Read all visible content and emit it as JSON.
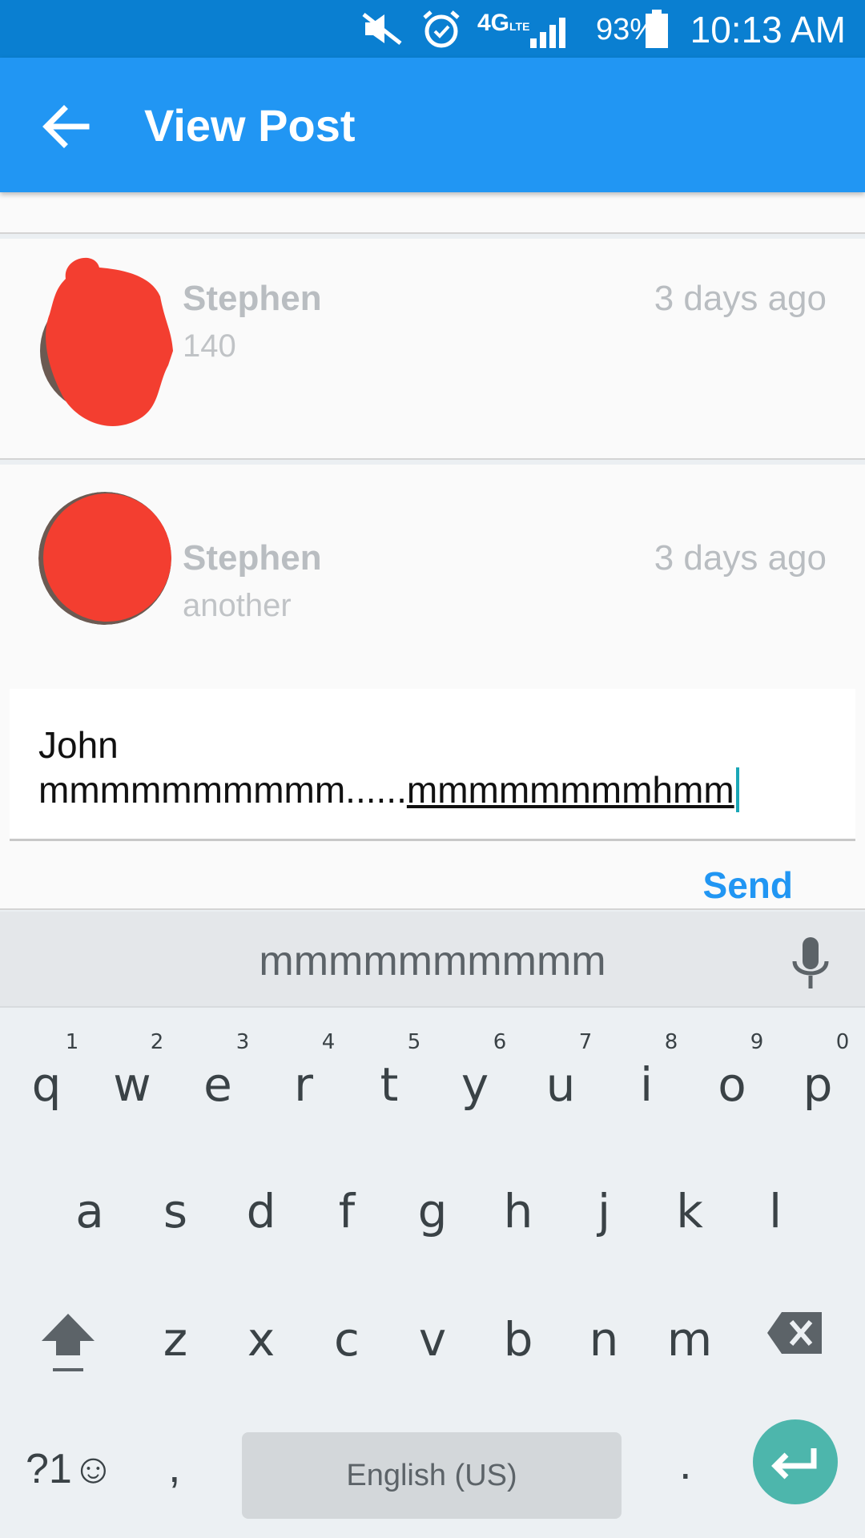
{
  "status_bar": {
    "battery": "93%",
    "time": "10:13 AM",
    "network": "4G LTE",
    "icons": [
      "mute-icon",
      "alarm-icon",
      "network-4g-icon",
      "signal-icon",
      "battery-icon"
    ]
  },
  "app_bar": {
    "title": "View Post",
    "back_icon": "arrow-left-icon"
  },
  "comments": [
    {
      "author": "Stephen",
      "time": "3 days ago",
      "text": "140"
    },
    {
      "author": "Stephen",
      "time": "3 days ago",
      "text": "another"
    }
  ],
  "comment_input": {
    "prefix": "John",
    "line2_plain": "mmmmmmmmmm......",
    "line2_composing": "mmmmmmmmhmm"
  },
  "send_label": "Send",
  "keyboard": {
    "suggestion": "mmmmmmmmmm",
    "row1": [
      "q",
      "w",
      "e",
      "r",
      "t",
      "y",
      "u",
      "i",
      "o",
      "p"
    ],
    "row1_hints": [
      "1",
      "2",
      "3",
      "4",
      "5",
      "6",
      "7",
      "8",
      "9",
      "0"
    ],
    "row2": [
      "a",
      "s",
      "d",
      "f",
      "g",
      "h",
      "j",
      "k",
      "l"
    ],
    "row3": [
      "z",
      "x",
      "c",
      "v",
      "b",
      "n",
      "m"
    ],
    "symbols_label": "?1☺",
    "comma": ",",
    "period": ".",
    "space_label": "English (US)"
  },
  "colors": {
    "status_bar": "#0a7fd1",
    "app_bar": "#2196f3",
    "send": "#2196f3",
    "enter_key": "#4db6ac",
    "redaction": "#f33e30"
  }
}
